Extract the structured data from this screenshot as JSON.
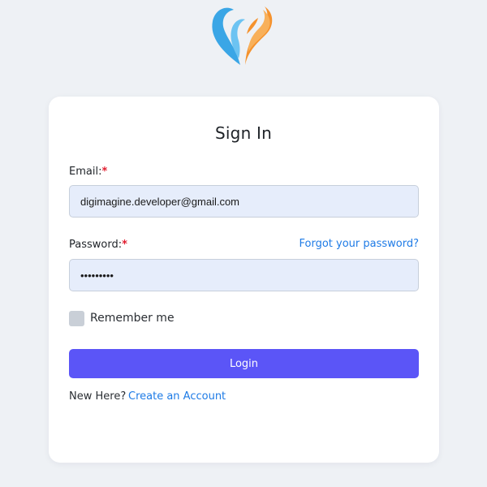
{
  "brand": {
    "logo_icon": "heart-flame-logo-icon",
    "colors": {
      "blue": "#3aa6e6",
      "orange": "#f5922d"
    }
  },
  "form": {
    "title": "Sign In",
    "email": {
      "label": "Email:",
      "required_mark": "*",
      "value": "digimagine.developer@gmail.com"
    },
    "password": {
      "label": "Password:",
      "required_mark": "*",
      "value": "secretpw9"
    },
    "forgot_link": "Forgot your password?",
    "remember_label": "Remember me",
    "remember_checked": false,
    "login_label": "Login",
    "signup_prompt": "New Here?",
    "signup_link": "Create an Account"
  },
  "colors": {
    "accent": "#5b55f7",
    "link": "#1e7be6",
    "required": "#e11d2f",
    "input_bg": "#e6edfb",
    "page_bg": "#eef1f5"
  }
}
